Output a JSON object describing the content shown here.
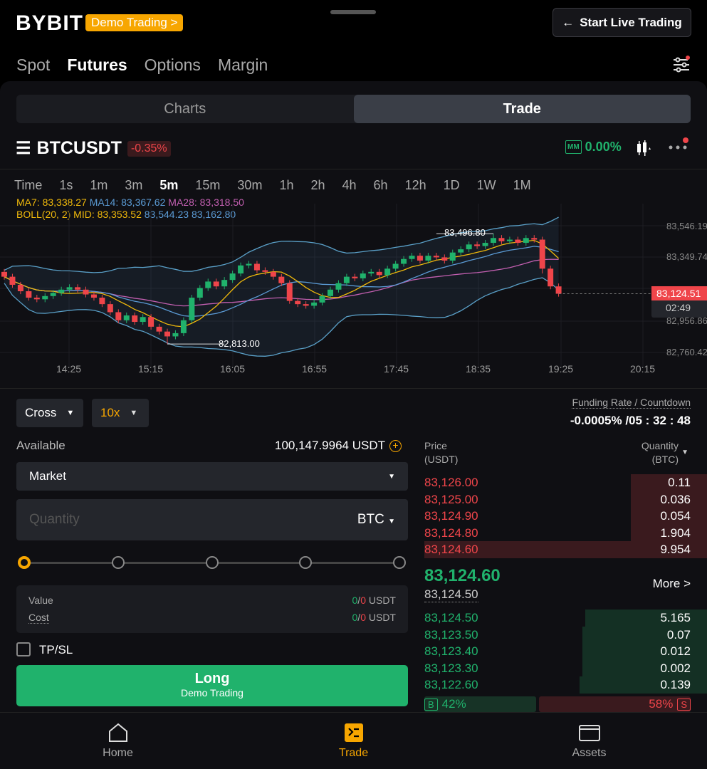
{
  "header": {
    "logo": "BYBIT",
    "demo_badge": "Demo Trading >",
    "live_button": "Start Live Trading"
  },
  "nav": {
    "tabs": [
      "Spot",
      "Futures",
      "Options",
      "Margin"
    ],
    "active": "Futures"
  },
  "view_toggle": {
    "charts": "Charts",
    "trade": "Trade"
  },
  "symbol": {
    "name": "BTCUSDT",
    "change": "-0.35%",
    "mm_badge": "MM",
    "mm_value": "0.00%"
  },
  "timeframes": [
    "Time",
    "1s",
    "1m",
    "3m",
    "5m",
    "15m",
    "30m",
    "1h",
    "2h",
    "4h",
    "6h",
    "12h",
    "1D",
    "1W",
    "1M"
  ],
  "indicators": {
    "ma7": "MA7: 83,338.27",
    "ma14": "MA14: 83,367.62",
    "ma28": "MA28: 83,318.50",
    "boll": "BOLL(20, 2) MID: 83,353.52",
    "boll_bands": "83,544.23 83,162.80"
  },
  "chart_data": {
    "type": "candlestick",
    "interval": "5m",
    "price_axis": [
      "83,546.19",
      "83,349.74",
      "82,956.86",
      "82,760.42"
    ],
    "time_axis": [
      "14:25",
      "15:15",
      "16:05",
      "16:55",
      "17:45",
      "18:35",
      "19:25",
      "20:15"
    ],
    "high_label": "83,496.80",
    "low_label": "82,813.00",
    "last_price": "83,124.51",
    "countdown": "02:49",
    "ylim": [
      82740,
      83560
    ],
    "closes": [
      83230,
      83180,
      83140,
      83100,
      83090,
      83110,
      83130,
      83150,
      83165,
      83150,
      83120,
      83100,
      83060,
      83010,
      82960,
      82990,
      82950,
      82980,
      82920,
      82890,
      82860,
      82880,
      82960,
      83100,
      83160,
      83200,
      83170,
      83210,
      83250,
      83300,
      83310,
      83270,
      83260,
      83230,
      83190,
      83080,
      83060,
      83050,
      83070,
      83110,
      83150,
      83190,
      83230,
      83220,
      83250,
      83260,
      83240,
      83280,
      83310,
      83340,
      83360,
      83330,
      83360,
      83350,
      83330,
      83380,
      83400,
      83430,
      83420,
      83440,
      83470,
      83450,
      83460,
      83440,
      83470,
      83460,
      83280,
      83170,
      83124.51
    ],
    "colors": {
      "up": "#20b26c",
      "down": "#ef454a",
      "ma7": "#f0b90b",
      "ma14": "#5b9bd5",
      "ma28": "#c25fb0",
      "boll": "#5aa0c8"
    }
  },
  "order": {
    "margin_mode": "Cross",
    "leverage": "10x",
    "available_label": "Available",
    "available_value": "100,147.9964 USDT",
    "order_type": "Market",
    "quantity_placeholder": "Quantity",
    "quantity_unit": "BTC",
    "value_label": "Value",
    "cost_label": "Cost",
    "value_a": "0",
    "value_b": "0",
    "cost_a": "0",
    "cost_b": "0",
    "unit": "USDT",
    "slash": "/",
    "tpsl": "TP/SL",
    "long_button": "Long",
    "long_sub": "Demo Trading",
    "slider_percent": 0
  },
  "funding": {
    "label": "Funding Rate / Countdown",
    "value": "-0.0005% /05 : 32 : 48"
  },
  "orderbook": {
    "price_header": "Price",
    "price_unit": "(USDT)",
    "qty_header": "Quantity",
    "qty_unit": "(BTC)",
    "asks": [
      {
        "p": "83,126.00",
        "q": "0.11",
        "d": 0.27
      },
      {
        "p": "83,125.00",
        "q": "0.036",
        "d": 0.27
      },
      {
        "p": "83,124.90",
        "q": "0.054",
        "d": 0.27
      },
      {
        "p": "83,124.80",
        "q": "1.904",
        "d": 0.27
      },
      {
        "p": "83,124.60",
        "q": "9.954",
        "d": 1
      }
    ],
    "last": "83,124.60",
    "mark": "83,124.50",
    "more": "More >",
    "bids": [
      {
        "p": "83,124.50",
        "q": "5.165",
        "d": 0.43
      },
      {
        "p": "83,123.50",
        "q": "0.07",
        "d": 0.44
      },
      {
        "p": "83,123.40",
        "q": "0.012",
        "d": 0.44
      },
      {
        "p": "83,123.30",
        "q": "0.002",
        "d": 0.44
      },
      {
        "p": "83,122.60",
        "q": "0.139",
        "d": 0.45
      }
    ],
    "buy_pct": "42%",
    "sell_pct": "58%",
    "buy_badge": "B",
    "sell_badge": "S",
    "buy_ratio": 0.42
  },
  "bottom_nav": {
    "home": "Home",
    "trade": "Trade",
    "assets": "Assets"
  }
}
